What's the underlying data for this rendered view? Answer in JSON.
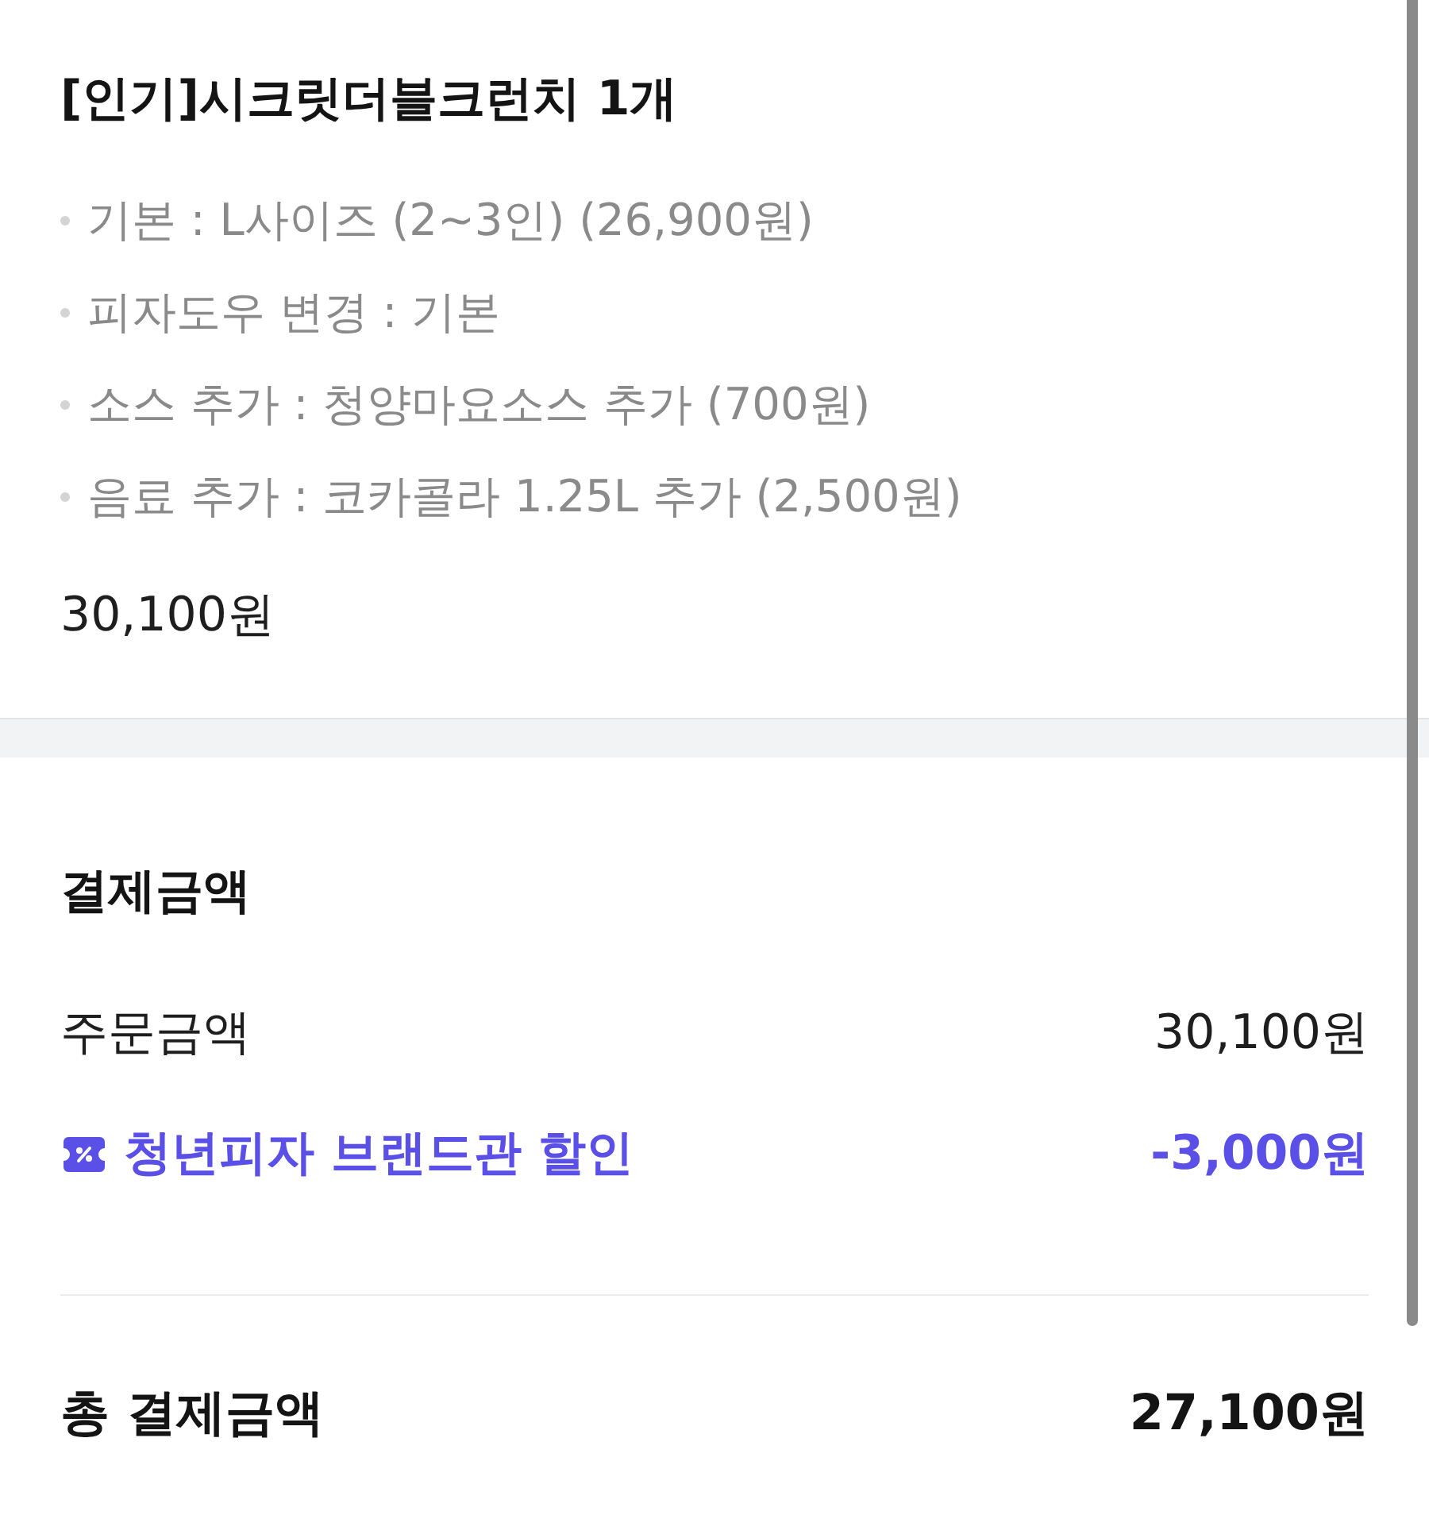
{
  "order_item": {
    "title": "[인기]시크릿더블크런치 1개",
    "options": [
      "기본 : L사이즈 (2~3인) (26,900원)",
      "피자도우 변경 : 기본",
      "소스 추가 : 청양마요소스 추가 (700원)",
      "음료 추가 : 코카콜라 1.25L 추가 (2,500원)"
    ],
    "price": "30,100원"
  },
  "payment": {
    "title": "결제금액",
    "rows": [
      {
        "kind": "plain",
        "label": "주문금액",
        "amount": "30,100원"
      },
      {
        "kind": "discount",
        "label": "청년피자 브랜드관 할인",
        "amount": "-3,000원"
      }
    ],
    "total": {
      "label": "총 결제금액",
      "amount": "27,100원"
    }
  }
}
